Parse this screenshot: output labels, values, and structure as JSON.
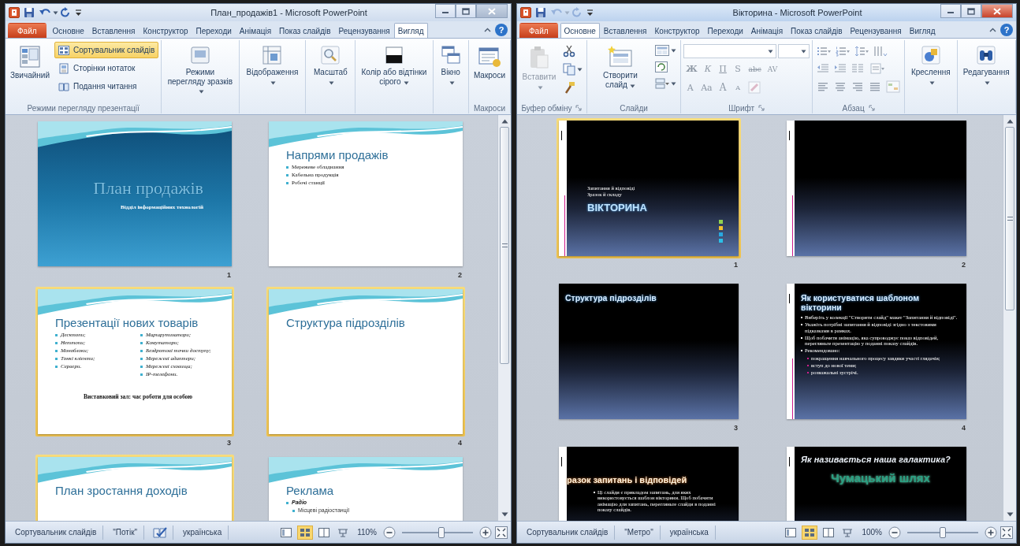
{
  "windows": [
    {
      "title": "План_продажів1 - Microsoft PowerPoint",
      "active": false,
      "undo_available": true,
      "help": "?",
      "tabs": [
        {
          "label": "Файл",
          "kind": "file",
          "selected": false
        },
        {
          "label": "Основне",
          "kind": "tab",
          "selected": false
        },
        {
          "label": "Вставлення",
          "kind": "tab",
          "selected": false
        },
        {
          "label": "Конструктор",
          "kind": "tab",
          "selected": false
        },
        {
          "label": "Переходи",
          "kind": "tab",
          "selected": false
        },
        {
          "label": "Анімація",
          "kind": "tab",
          "selected": false
        },
        {
          "label": "Показ слайдів",
          "kind": "tab",
          "selected": false
        },
        {
          "label": "Рецензування",
          "kind": "tab",
          "selected": false
        },
        {
          "label": "Вигляд",
          "kind": "tab",
          "selected": true
        }
      ],
      "ribbon": [
        {
          "kind": "buttons",
          "label": "Режими перегляду презентації",
          "launcher": false,
          "items": [
            {
              "kind": "large",
              "label": "Звичайний",
              "selected": false
            },
            {
              "kind": "small",
              "label": "Сортувальник слайдів",
              "selected": true
            },
            {
              "kind": "small",
              "label": "Сторінки нотаток",
              "selected": false
            },
            {
              "kind": "small",
              "label": "Подання читання",
              "selected": false
            }
          ]
        },
        {
          "kind": "buttons",
          "items": [
            {
              "kind": "large",
              "label": "Режими перегляду зразків",
              "dropdown": true
            }
          ]
        },
        {
          "kind": "buttons",
          "items": [
            {
              "kind": "large",
              "label": "Відображення",
              "dropdown": true
            }
          ]
        },
        {
          "kind": "buttons",
          "items": [
            {
              "kind": "large",
              "label": "Масштаб",
              "dropdown": true
            }
          ]
        },
        {
          "kind": "buttons",
          "items": [
            {
              "kind": "large",
              "label": "Колір або відтінки сірого",
              "dropdown": true
            }
          ]
        },
        {
          "kind": "buttons",
          "items": [
            {
              "kind": "large",
              "label": "Вікно",
              "dropdown": true
            }
          ]
        },
        {
          "kind": "buttons",
          "label": "Макроси",
          "launcher": false,
          "items": [
            {
              "kind": "large",
              "label": "Макроси"
            }
          ]
        }
      ],
      "slides": [
        {
          "number": "1",
          "selected": false,
          "kind": "wave-title",
          "title": "План продажів",
          "subtitle": "Відділ інформаційних технологій"
        },
        {
          "number": "2",
          "selected": false,
          "kind": "wave-content",
          "title": "Напрями продажів",
          "bullets": [
            {
              "text": "Мережеве обладнання",
              "kind": "plain"
            },
            {
              "text": "Кабельна продукція",
              "kind": "plain"
            },
            {
              "text": "Робочі станції",
              "kind": "plain"
            }
          ]
        },
        {
          "number": "3",
          "selected": true,
          "kind": "wave-two-column",
          "title": "Презентації нових товарів",
          "columns": [
            [
              {
                "text": "Десктопи;",
                "kind": "italic"
              },
              {
                "text": "Неттопи;",
                "kind": "italic"
              },
              {
                "text": "Моноблоки;",
                "kind": "italic"
              },
              {
                "text": "Тонкі клієнти;",
                "kind": "italic"
              },
              {
                "text": "Сервери.",
                "kind": "italic"
              }
            ],
            [
              {
                "text": "Маршрутизатори;",
                "kind": "italic"
              },
              {
                "text": "Комутатори;",
                "kind": "italic"
              },
              {
                "text": "Бездротові точки доступу;",
                "kind": "italic"
              },
              {
                "text": "Мережеві адаптери;",
                "kind": "italic"
              },
              {
                "text": "Мережеві сховища;",
                "kind": "italic"
              },
              {
                "text": "IP-телефони.",
                "kind": "italic"
              }
            ]
          ],
          "footer": "Виставковий зал: час роботи для особою"
        },
        {
          "number": "4",
          "selected": true,
          "kind": "wave-content",
          "title": "Структура підрозділів"
        },
        {
          "selected": true,
          "kind": "wave-content",
          "title": "План зростання доходів"
        },
        {
          "selected": false,
          "kind": "wave-content",
          "title": "Реклама",
          "bullets": [
            {
              "text": "Радіо",
              "kind": "bold-italic",
              "children": [
                {
                  "text": "Місцеві радіостанції",
                  "kind": "plain"
                }
              ]
            }
          ]
        }
      ],
      "status_bar": {
        "view": "Сортувальник слайдів",
        "theme": "\"Потік\"",
        "proofing_errors": true,
        "language": "українська",
        "views": [
          {
            "selected": false
          },
          {
            "selected": true
          },
          {
            "selected": false
          },
          {
            "selected": false
          }
        ],
        "zoom": "110%",
        "level": 0.55
      }
    },
    {
      "title": "Вікторина - Microsoft PowerPoint",
      "active": true,
      "undo_available": false,
      "help": "?",
      "tabs": [
        {
          "label": "Файл",
          "kind": "file",
          "selected": false
        },
        {
          "label": "Основне",
          "kind": "tab",
          "selected": true
        },
        {
          "label": "Вставлення",
          "kind": "tab",
          "selected": false
        },
        {
          "label": "Конструктор",
          "kind": "tab",
          "selected": false
        },
        {
          "label": "Переходи",
          "kind": "tab",
          "selected": false
        },
        {
          "label": "Анімація",
          "kind": "tab",
          "selected": false
        },
        {
          "label": "Показ слайдів",
          "kind": "tab",
          "selected": false
        },
        {
          "label": "Рецензування",
          "kind": "tab",
          "selected": false
        },
        {
          "label": "Вигляд",
          "kind": "tab",
          "selected": false
        }
      ],
      "ribbon": [
        {
          "kind": "clipboard",
          "label": "Буфер обміну",
          "launcher": true,
          "items": [
            {
              "kind": "large",
              "label": "Вставити",
              "disabled": true,
              "dropdown": true
            }
          ]
        },
        {
          "kind": "slides",
          "label": "Слайди",
          "launcher": false,
          "items": [
            {
              "kind": "large",
              "label": "Створити слайд",
              "dropdown": true
            }
          ]
        },
        {
          "kind": "font",
          "label": "Шрифт",
          "launcher": true,
          "disabled": true,
          "format_buttons": [
            {
              "label": "Ж",
              "kind": "bold"
            },
            {
              "label": "К",
              "kind": "italic"
            },
            {
              "label": "П",
              "kind": "underline"
            },
            {
              "label": "S",
              "kind": "shadow"
            },
            {
              "label": "abc",
              "kind": "strike"
            },
            {
              "label": "AV",
              "kind": "spacing"
            }
          ],
          "size_buttons": [
            {
              "label": "A",
              "kind": "color"
            },
            {
              "label": "Aa",
              "kind": "case"
            },
            {
              "label": "A",
              "kind": "grow"
            },
            {
              "label": "A",
              "kind": "shrink"
            }
          ]
        },
        {
          "kind": "paragraph",
          "label": "Абзац",
          "launcher": true,
          "disabled": true
        },
        {
          "kind": "buttons",
          "items": [
            {
              "kind": "large",
              "label": "Креслення",
              "dropdown": true
            }
          ]
        },
        {
          "kind": "buttons",
          "items": [
            {
              "kind": "large",
              "label": "Редагування",
              "dropdown": true
            }
          ]
        }
      ],
      "slides": [
        {
          "number": "1",
          "selected": true,
          "kind": "dark-title",
          "side_strip": true,
          "kicker": [
            "Запитання й відповіді",
            "Зразок й складу"
          ],
          "title": "ВІКТОРИНА"
        },
        {
          "number": "2",
          "selected": false,
          "kind": "dark-blank",
          "side_strip": true
        },
        {
          "number": "3",
          "selected": false,
          "kind": "dark-content",
          "side_strip": false,
          "title": "Структура підрозділів"
        },
        {
          "number": "4",
          "selected": false,
          "kind": "dark-content",
          "side_strip": true,
          "title": "Як користуватися шаблоном вікторини",
          "bullets": [
            {
              "text": "Виберіть у колекції \"Створити слайд\" макет \"Запитання й відповіді\".",
              "kind": "plain"
            },
            {
              "text": "Укажіть потрібні запитання й відповіді згідно з текстовими підказками в рамках.",
              "kind": "plain"
            },
            {
              "text": "Щоб побачити анімацію, яка супроводжує показ відповідей, перегляньте презентацію у поданні показу слайдів.",
              "kind": "plain"
            },
            {
              "text": "Рекомендовано:",
              "kind": "plain",
              "children": [
                {
                  "text": "покращення навчального процесу завдяки участі глядачів;",
                  "kind": "plain"
                },
                {
                  "text": "вступ до нової теми;",
                  "kind": "plain"
                },
                {
                  "text": "розважальні зустрічі.",
                  "kind": "plain"
                }
              ]
            }
          ]
        },
        {
          "selected": false,
          "kind": "dark-section",
          "side_strip": true,
          "title": "разок запитань і відповідей",
          "bullets": [
            {
              "text": "Ці слайди є прикладом запитань, для яких використовується шаблон вікторини. Щоб побачити анімацію для запитань, перегляньте слайди в поданні показу слайдів.",
              "kind": "plain"
            }
          ]
        },
        {
          "selected": false,
          "kind": "dark-question",
          "side_strip": true,
          "title": "Як називається наша галактика?",
          "answer": "Чумацький шлях"
        }
      ],
      "status_bar": {
        "view": "Сортувальник слайдів",
        "theme": "\"Метро\"",
        "proofing_errors": false,
        "language": "українська",
        "views": [
          {
            "selected": false
          },
          {
            "selected": true
          },
          {
            "selected": false
          },
          {
            "selected": false
          }
        ],
        "zoom": "100%",
        "level": 0.5
      }
    }
  ]
}
